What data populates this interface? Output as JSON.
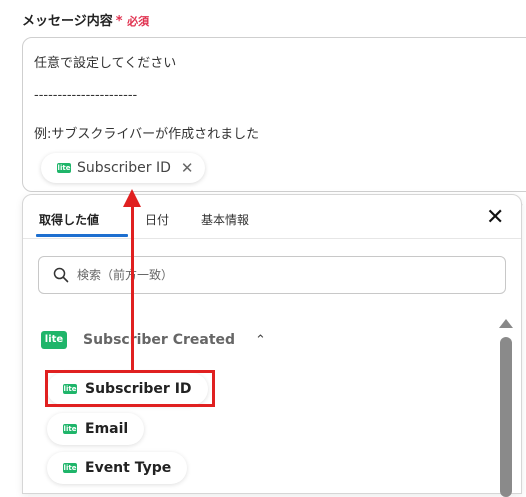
{
  "field": {
    "label": "メッセージ内容",
    "required_star": "*",
    "required_text": "必須"
  },
  "message": {
    "line1": "任意で設定してください",
    "line2": "----------------------",
    "line3": "例:サブスクライバーが作成されました",
    "chip_label": "Subscriber ID",
    "chip_icon_text": "lite"
  },
  "panel": {
    "tabs": [
      {
        "label": "取得した値",
        "active": true
      },
      {
        "label": "日付",
        "active": false
      },
      {
        "label": "基本情報",
        "active": false
      }
    ],
    "search_placeholder": "検索（前方一致）",
    "group": {
      "icon_text": "lite",
      "title": "Subscriber Created"
    },
    "items": [
      {
        "label": "Subscriber ID",
        "icon_text": "lite"
      },
      {
        "label": "Email",
        "icon_text": "lite"
      },
      {
        "label": "Event Type",
        "icon_text": "lite"
      }
    ]
  },
  "colors": {
    "accent": "#1d6fd0",
    "required": "#e0314f",
    "brand_lite": "#1fb56a",
    "annotation": "#e02020"
  }
}
